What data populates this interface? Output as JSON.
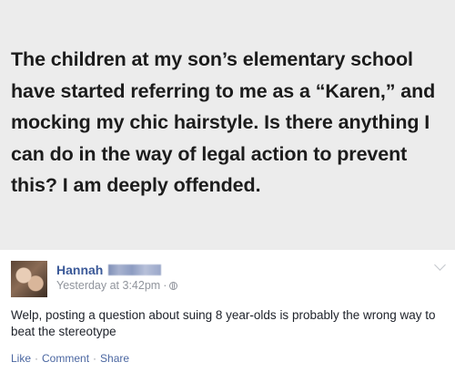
{
  "post": {
    "text": "The children at my son’s elementary school have started referring to me as a “Karen,” and mocking my chic hairstyle. Is there anything I can do in the way of legal action to prevent this? I am deeply offended."
  },
  "comment": {
    "author": "Hannah",
    "timestamp": "Yesterday at 3:42pm",
    "separator": "·",
    "text": "Welp, posting a question about suing 8 year-olds is probably the wrong way to beat the stereotype",
    "actions": {
      "like": "Like",
      "comment": "Comment",
      "share": "Share"
    }
  },
  "icons": [
    "globe-icon",
    "chevron-down-icon"
  ],
  "colors": {
    "link": "#3b5998",
    "meta": "#90949c",
    "post_background": "#ececec"
  }
}
